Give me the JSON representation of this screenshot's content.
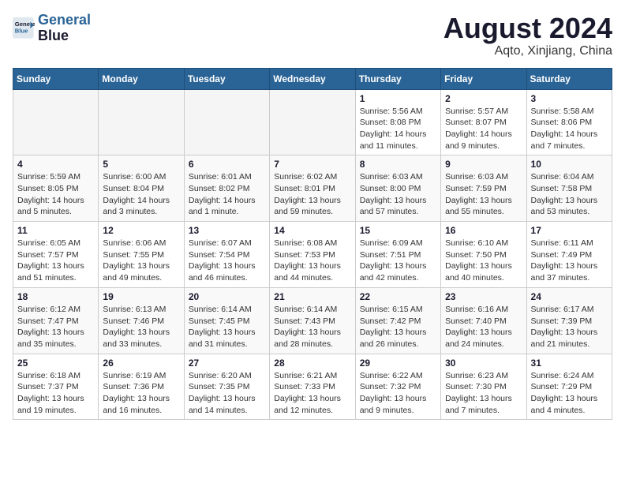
{
  "logo": {
    "line1": "General",
    "line2": "Blue"
  },
  "title": "August 2024",
  "location": "Aqto, Xinjiang, China",
  "days_header": [
    "Sunday",
    "Monday",
    "Tuesday",
    "Wednesday",
    "Thursday",
    "Friday",
    "Saturday"
  ],
  "weeks": [
    [
      {
        "day": "",
        "empty": true
      },
      {
        "day": "",
        "empty": true
      },
      {
        "day": "",
        "empty": true
      },
      {
        "day": "",
        "empty": true
      },
      {
        "day": "1",
        "sunrise": "5:56 AM",
        "sunset": "8:08 PM",
        "daylight": "14 hours and 11 minutes."
      },
      {
        "day": "2",
        "sunrise": "5:57 AM",
        "sunset": "8:07 PM",
        "daylight": "14 hours and 9 minutes."
      },
      {
        "day": "3",
        "sunrise": "5:58 AM",
        "sunset": "8:06 PM",
        "daylight": "14 hours and 7 minutes."
      }
    ],
    [
      {
        "day": "4",
        "sunrise": "5:59 AM",
        "sunset": "8:05 PM",
        "daylight": "14 hours and 5 minutes."
      },
      {
        "day": "5",
        "sunrise": "6:00 AM",
        "sunset": "8:04 PM",
        "daylight": "14 hours and 3 minutes."
      },
      {
        "day": "6",
        "sunrise": "6:01 AM",
        "sunset": "8:02 PM",
        "daylight": "14 hours and 1 minute."
      },
      {
        "day": "7",
        "sunrise": "6:02 AM",
        "sunset": "8:01 PM",
        "daylight": "13 hours and 59 minutes."
      },
      {
        "day": "8",
        "sunrise": "6:03 AM",
        "sunset": "8:00 PM",
        "daylight": "13 hours and 57 minutes."
      },
      {
        "day": "9",
        "sunrise": "6:03 AM",
        "sunset": "7:59 PM",
        "daylight": "13 hours and 55 minutes."
      },
      {
        "day": "10",
        "sunrise": "6:04 AM",
        "sunset": "7:58 PM",
        "daylight": "13 hours and 53 minutes."
      }
    ],
    [
      {
        "day": "11",
        "sunrise": "6:05 AM",
        "sunset": "7:57 PM",
        "daylight": "13 hours and 51 minutes."
      },
      {
        "day": "12",
        "sunrise": "6:06 AM",
        "sunset": "7:55 PM",
        "daylight": "13 hours and 49 minutes."
      },
      {
        "day": "13",
        "sunrise": "6:07 AM",
        "sunset": "7:54 PM",
        "daylight": "13 hours and 46 minutes."
      },
      {
        "day": "14",
        "sunrise": "6:08 AM",
        "sunset": "7:53 PM",
        "daylight": "13 hours and 44 minutes."
      },
      {
        "day": "15",
        "sunrise": "6:09 AM",
        "sunset": "7:51 PM",
        "daylight": "13 hours and 42 minutes."
      },
      {
        "day": "16",
        "sunrise": "6:10 AM",
        "sunset": "7:50 PM",
        "daylight": "13 hours and 40 minutes."
      },
      {
        "day": "17",
        "sunrise": "6:11 AM",
        "sunset": "7:49 PM",
        "daylight": "13 hours and 37 minutes."
      }
    ],
    [
      {
        "day": "18",
        "sunrise": "6:12 AM",
        "sunset": "7:47 PM",
        "daylight": "13 hours and 35 minutes."
      },
      {
        "day": "19",
        "sunrise": "6:13 AM",
        "sunset": "7:46 PM",
        "daylight": "13 hours and 33 minutes."
      },
      {
        "day": "20",
        "sunrise": "6:14 AM",
        "sunset": "7:45 PM",
        "daylight": "13 hours and 31 minutes."
      },
      {
        "day": "21",
        "sunrise": "6:14 AM",
        "sunset": "7:43 PM",
        "daylight": "13 hours and 28 minutes."
      },
      {
        "day": "22",
        "sunrise": "6:15 AM",
        "sunset": "7:42 PM",
        "daylight": "13 hours and 26 minutes."
      },
      {
        "day": "23",
        "sunrise": "6:16 AM",
        "sunset": "7:40 PM",
        "daylight": "13 hours and 24 minutes."
      },
      {
        "day": "24",
        "sunrise": "6:17 AM",
        "sunset": "7:39 PM",
        "daylight": "13 hours and 21 minutes."
      }
    ],
    [
      {
        "day": "25",
        "sunrise": "6:18 AM",
        "sunset": "7:37 PM",
        "daylight": "13 hours and 19 minutes."
      },
      {
        "day": "26",
        "sunrise": "6:19 AM",
        "sunset": "7:36 PM",
        "daylight": "13 hours and 16 minutes."
      },
      {
        "day": "27",
        "sunrise": "6:20 AM",
        "sunset": "7:35 PM",
        "daylight": "13 hours and 14 minutes."
      },
      {
        "day": "28",
        "sunrise": "6:21 AM",
        "sunset": "7:33 PM",
        "daylight": "13 hours and 12 minutes."
      },
      {
        "day": "29",
        "sunrise": "6:22 AM",
        "sunset": "7:32 PM",
        "daylight": "13 hours and 9 minutes."
      },
      {
        "day": "30",
        "sunrise": "6:23 AM",
        "sunset": "7:30 PM",
        "daylight": "13 hours and 7 minutes."
      },
      {
        "day": "31",
        "sunrise": "6:24 AM",
        "sunset": "7:29 PM",
        "daylight": "13 hours and 4 minutes."
      }
    ]
  ]
}
